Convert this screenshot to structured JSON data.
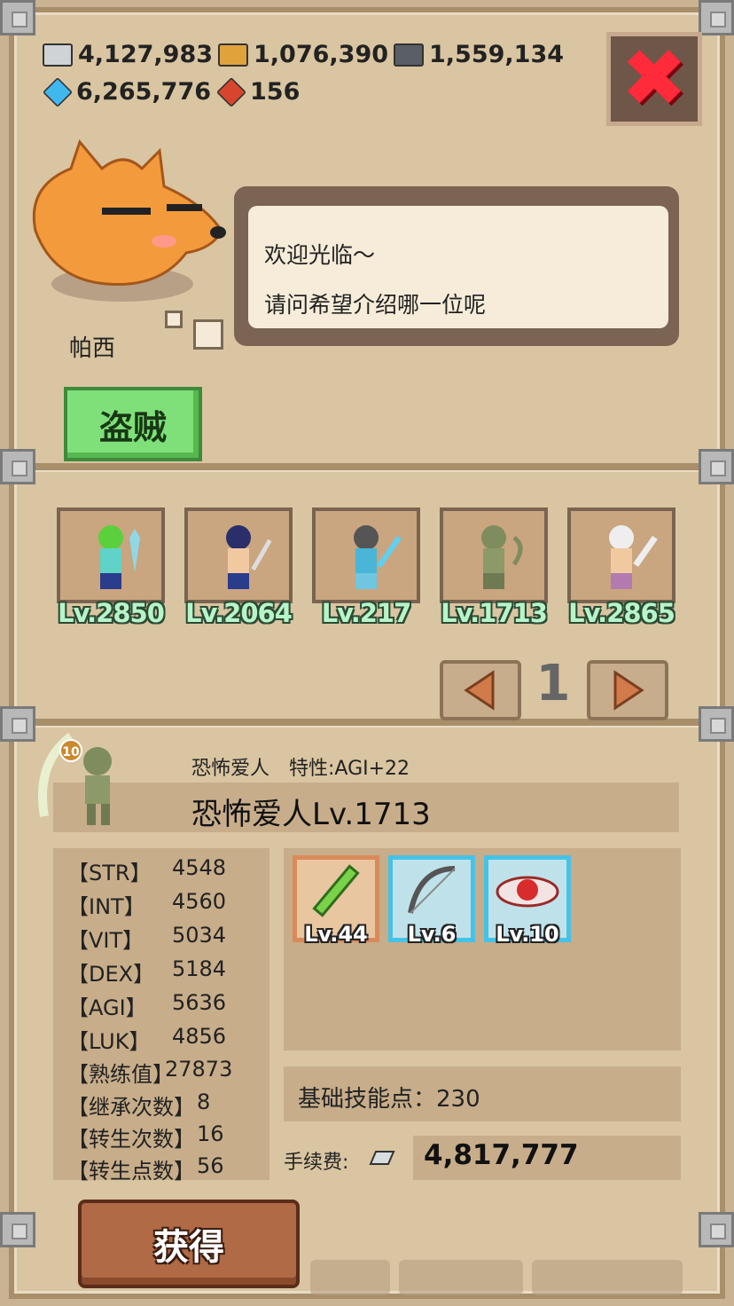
{
  "resources": [
    {
      "icon": "silver-ingot-icon",
      "value": "4,127,983",
      "color": "#cfd3d6"
    },
    {
      "icon": "wood-icon",
      "value": "1,076,390",
      "color": "#e0a33c"
    },
    {
      "icon": "ore-icon",
      "value": "1,559,134",
      "color": "#5a5e66"
    },
    {
      "icon": "blue-gem-icon",
      "value": "6,265,776",
      "color": "#3fb7ef"
    },
    {
      "icon": "red-gem-icon",
      "value": "156",
      "color": "#d8452e"
    }
  ],
  "close": {
    "glyph": "✖"
  },
  "npc": {
    "name": "帕西",
    "speech_line1": "欢迎光临～",
    "speech_line2": "请问希望介绍哪一位呢"
  },
  "class_button": {
    "label": "盗贼"
  },
  "heroes": [
    {
      "level": "Lv.2850",
      "tint": "#5fd3c8",
      "hair": "#5ad13c"
    },
    {
      "level": "Lv.2064",
      "tint": "#2a3c8c",
      "hair": "#2a2e6a"
    },
    {
      "level": "Lv.217",
      "tint": "#49b6d8",
      "hair": "#555"
    },
    {
      "level": "Lv.1713",
      "tint": "#8c9a6a",
      "hair": "#7f8c5e"
    },
    {
      "level": "Lv.2865",
      "tint": "#b37ab0",
      "hair": "#eee"
    }
  ],
  "pager": {
    "page": "1",
    "prev": "◀",
    "next": "▶"
  },
  "selected": {
    "badge": "10",
    "small": "恐怖爱人　特性:AGI+22",
    "title": "恐怖爱人Lv.1713",
    "stats": [
      {
        "label": "【STR】",
        "value": "4548"
      },
      {
        "label": "【INT】",
        "value": "4560"
      },
      {
        "label": "【VIT】",
        "value": "5034"
      },
      {
        "label": "【DEX】",
        "value": "5184"
      },
      {
        "label": "【AGI】",
        "value": "5636"
      },
      {
        "label": "【LUK】",
        "value": "4856"
      },
      {
        "label": "【熟练值】",
        "value": "27873"
      },
      {
        "label": "【继承次数】",
        "value": "8"
      },
      {
        "label": "【转生次数】",
        "value": "16"
      },
      {
        "label": "【转生点数】",
        "value": "56"
      }
    ],
    "skills": [
      {
        "icon": "green-blade-skill-icon",
        "level": "Lv.44",
        "border": "#d98a5a",
        "bg": "#e8c6a0"
      },
      {
        "icon": "bow-skill-icon",
        "level": "Lv.6",
        "border": "#46c2e6",
        "bg": "#bfe2ea"
      },
      {
        "icon": "red-eye-skill-icon",
        "level": "Lv.10",
        "border": "#46c2e6",
        "bg": "#bfe2ea"
      }
    ],
    "skill_points": "基础技能点：230",
    "fee_label": "手续费:",
    "fee_value": "4,817,777"
  },
  "get_button": {
    "label": "获得"
  }
}
